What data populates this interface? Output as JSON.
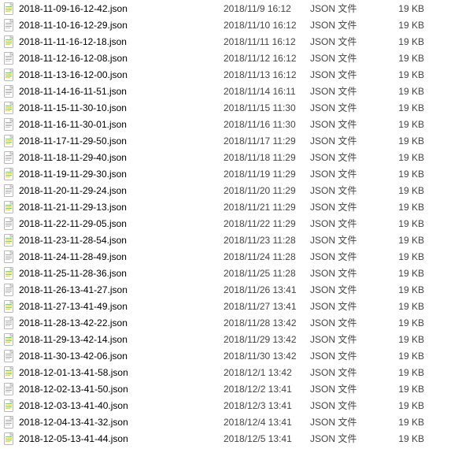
{
  "files": [
    {
      "name": "2018-11-09-16-12-42.json",
      "date": "2018/11/9 16:12",
      "type": "JSON 文件",
      "size": "19 KB"
    },
    {
      "name": "2018-11-10-16-12-29.json",
      "date": "2018/11/10 16:12",
      "type": "JSON 文件",
      "size": "19 KB"
    },
    {
      "name": "2018-11-11-16-12-18.json",
      "date": "2018/11/11 16:12",
      "type": "JSON 文件",
      "size": "19 KB"
    },
    {
      "name": "2018-11-12-16-12-08.json",
      "date": "2018/11/12 16:12",
      "type": "JSON 文件",
      "size": "19 KB"
    },
    {
      "name": "2018-11-13-16-12-00.json",
      "date": "2018/11/13 16:12",
      "type": "JSON 文件",
      "size": "19 KB"
    },
    {
      "name": "2018-11-14-16-11-51.json",
      "date": "2018/11/14 16:11",
      "type": "JSON 文件",
      "size": "19 KB"
    },
    {
      "name": "2018-11-15-11-30-10.json",
      "date": "2018/11/15 11:30",
      "type": "JSON 文件",
      "size": "19 KB"
    },
    {
      "name": "2018-11-16-11-30-01.json",
      "date": "2018/11/16 11:30",
      "type": "JSON 文件",
      "size": "19 KB"
    },
    {
      "name": "2018-11-17-11-29-50.json",
      "date": "2018/11/17 11:29",
      "type": "JSON 文件",
      "size": "19 KB"
    },
    {
      "name": "2018-11-18-11-29-40.json",
      "date": "2018/11/18 11:29",
      "type": "JSON 文件",
      "size": "19 KB"
    },
    {
      "name": "2018-11-19-11-29-30.json",
      "date": "2018/11/19 11:29",
      "type": "JSON 文件",
      "size": "19 KB"
    },
    {
      "name": "2018-11-20-11-29-24.json",
      "date": "2018/11/20 11:29",
      "type": "JSON 文件",
      "size": "19 KB"
    },
    {
      "name": "2018-11-21-11-29-13.json",
      "date": "2018/11/21 11:29",
      "type": "JSON 文件",
      "size": "19 KB"
    },
    {
      "name": "2018-11-22-11-29-05.json",
      "date": "2018/11/22 11:29",
      "type": "JSON 文件",
      "size": "19 KB"
    },
    {
      "name": "2018-11-23-11-28-54.json",
      "date": "2018/11/23 11:28",
      "type": "JSON 文件",
      "size": "19 KB"
    },
    {
      "name": "2018-11-24-11-28-49.json",
      "date": "2018/11/24 11:28",
      "type": "JSON 文件",
      "size": "19 KB"
    },
    {
      "name": "2018-11-25-11-28-36.json",
      "date": "2018/11/25 11:28",
      "type": "JSON 文件",
      "size": "19 KB"
    },
    {
      "name": "2018-11-26-13-41-27.json",
      "date": "2018/11/26 13:41",
      "type": "JSON 文件",
      "size": "19 KB"
    },
    {
      "name": "2018-11-27-13-41-49.json",
      "date": "2018/11/27 13:41",
      "type": "JSON 文件",
      "size": "19 KB"
    },
    {
      "name": "2018-11-28-13-42-22.json",
      "date": "2018/11/28 13:42",
      "type": "JSON 文件",
      "size": "19 KB"
    },
    {
      "name": "2018-11-29-13-42-14.json",
      "date": "2018/11/29 13:42",
      "type": "JSON 文件",
      "size": "19 KB"
    },
    {
      "name": "2018-11-30-13-42-06.json",
      "date": "2018/11/30 13:42",
      "type": "JSON 文件",
      "size": "19 KB"
    },
    {
      "name": "2018-12-01-13-41-58.json",
      "date": "2018/12/1 13:42",
      "type": "JSON 文件",
      "size": "19 KB"
    },
    {
      "name": "2018-12-02-13-41-50.json",
      "date": "2018/12/2 13:41",
      "type": "JSON 文件",
      "size": "19 KB"
    },
    {
      "name": "2018-12-03-13-41-40.json",
      "date": "2018/12/3 13:41",
      "type": "JSON 文件",
      "size": "19 KB"
    },
    {
      "name": "2018-12-04-13-41-32.json",
      "date": "2018/12/4 13:41",
      "type": "JSON 文件",
      "size": "19 KB"
    },
    {
      "name": "2018-12-05-13-41-44.json",
      "date": "2018/12/5 13:41",
      "type": "JSON 文件",
      "size": "19 KB"
    }
  ]
}
